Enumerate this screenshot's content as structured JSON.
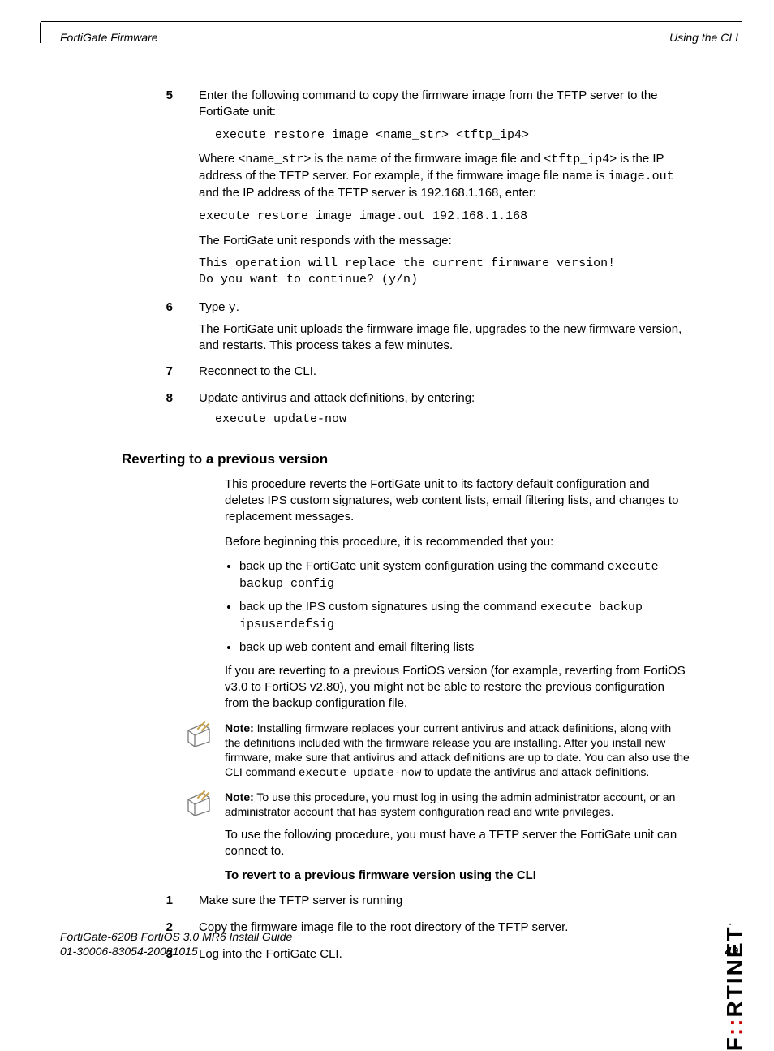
{
  "header": {
    "left": "FortiGate Firmware",
    "right": "Using the CLI"
  },
  "steps_a": {
    "s5": {
      "num": "5",
      "p1": "Enter the following command to copy the firmware image from the TFTP server to the FortiGate unit:",
      "code1": "execute restore image <name_str> <tftp_ip4>",
      "p2a": "Where ",
      "p2b": "<name_str>",
      "p2c": " is the name of the firmware image file and ",
      "p2d": "<tftp_ip4>",
      "p2e": " is the IP address of the TFTP server. For example, if the firmware image file name is ",
      "p2f": "image.out",
      "p2g": " and the IP address of the TFTP server is 192.168.1.168, enter:",
      "code2": "execute restore image image.out 192.168.1.168",
      "p3": "The FortiGate unit responds with the message:",
      "code3": "This operation will replace the current firmware version!\nDo you want to continue? (y/n)"
    },
    "s6": {
      "num": "6",
      "p1a": "Type ",
      "p1b": "y",
      "p1c": ".",
      "p2": "The FortiGate unit uploads the firmware image file, upgrades to the new firmware version, and restarts. This process takes a few minutes."
    },
    "s7": {
      "num": "7",
      "p1": "Reconnect to the CLI."
    },
    "s8": {
      "num": "8",
      "p1": "Update antivirus and attack definitions, by entering:",
      "code1": "execute update-now"
    }
  },
  "section": {
    "title": "Reverting to a previous version",
    "p1": "This procedure reverts the FortiGate unit to its factory default configuration and deletes IPS custom signatures, web content lists, email filtering lists, and changes to replacement messages.",
    "p2": "Before beginning this procedure, it is recommended that you:",
    "bullets": {
      "b1a": "back up the FortiGate unit system configuration using the command ",
      "b1b": "execute backup config",
      "b2a": "back up the IPS custom signatures using the command ",
      "b2b": "execute backup ipsuserdefsig",
      "b3": "back up web content and email filtering lists"
    },
    "p3": "If you are reverting to a previous FortiOS version (for example, reverting from FortiOS v3.0 to FortiOS v2.80), you might not be able to restore the previous configuration from the backup configuration file.",
    "note1a": "Note:",
    "note1b": " Installing firmware replaces your current antivirus and attack definitions, along with the definitions included with the firmware release you are installing. After you install new firmware, make sure that antivirus and attack definitions are up to date. You can also use the CLI command ",
    "note1c": "execute update-now",
    "note1d": " to update the antivirus and attack definitions.",
    "note2a": "Note:",
    "note2b": " To use this procedure, you must log in using the admin administrator account, or an administrator account that has system configuration read and write privileges.",
    "p4": "To use the following procedure, you must have a TFTP server the FortiGate unit can connect to.",
    "sub": "To revert to a previous firmware version using the CLI"
  },
  "steps_b": {
    "s1": {
      "num": "1",
      "p1": "Make sure the TFTP server is running"
    },
    "s2": {
      "num": "2",
      "p1": "Copy the firmware image file to the root directory of the TFTP server."
    },
    "s3": {
      "num": "3",
      "p1": "Log into the FortiGate CLI."
    }
  },
  "footer": {
    "line1": "FortiGate-620B FortiOS 3.0 MR6 Install Guide",
    "line2": "01-30006-83054-20081015",
    "page": "49"
  },
  "brand": {
    "pre": "F",
    "dots": "::",
    "post": "RTINET",
    "tm": "."
  }
}
